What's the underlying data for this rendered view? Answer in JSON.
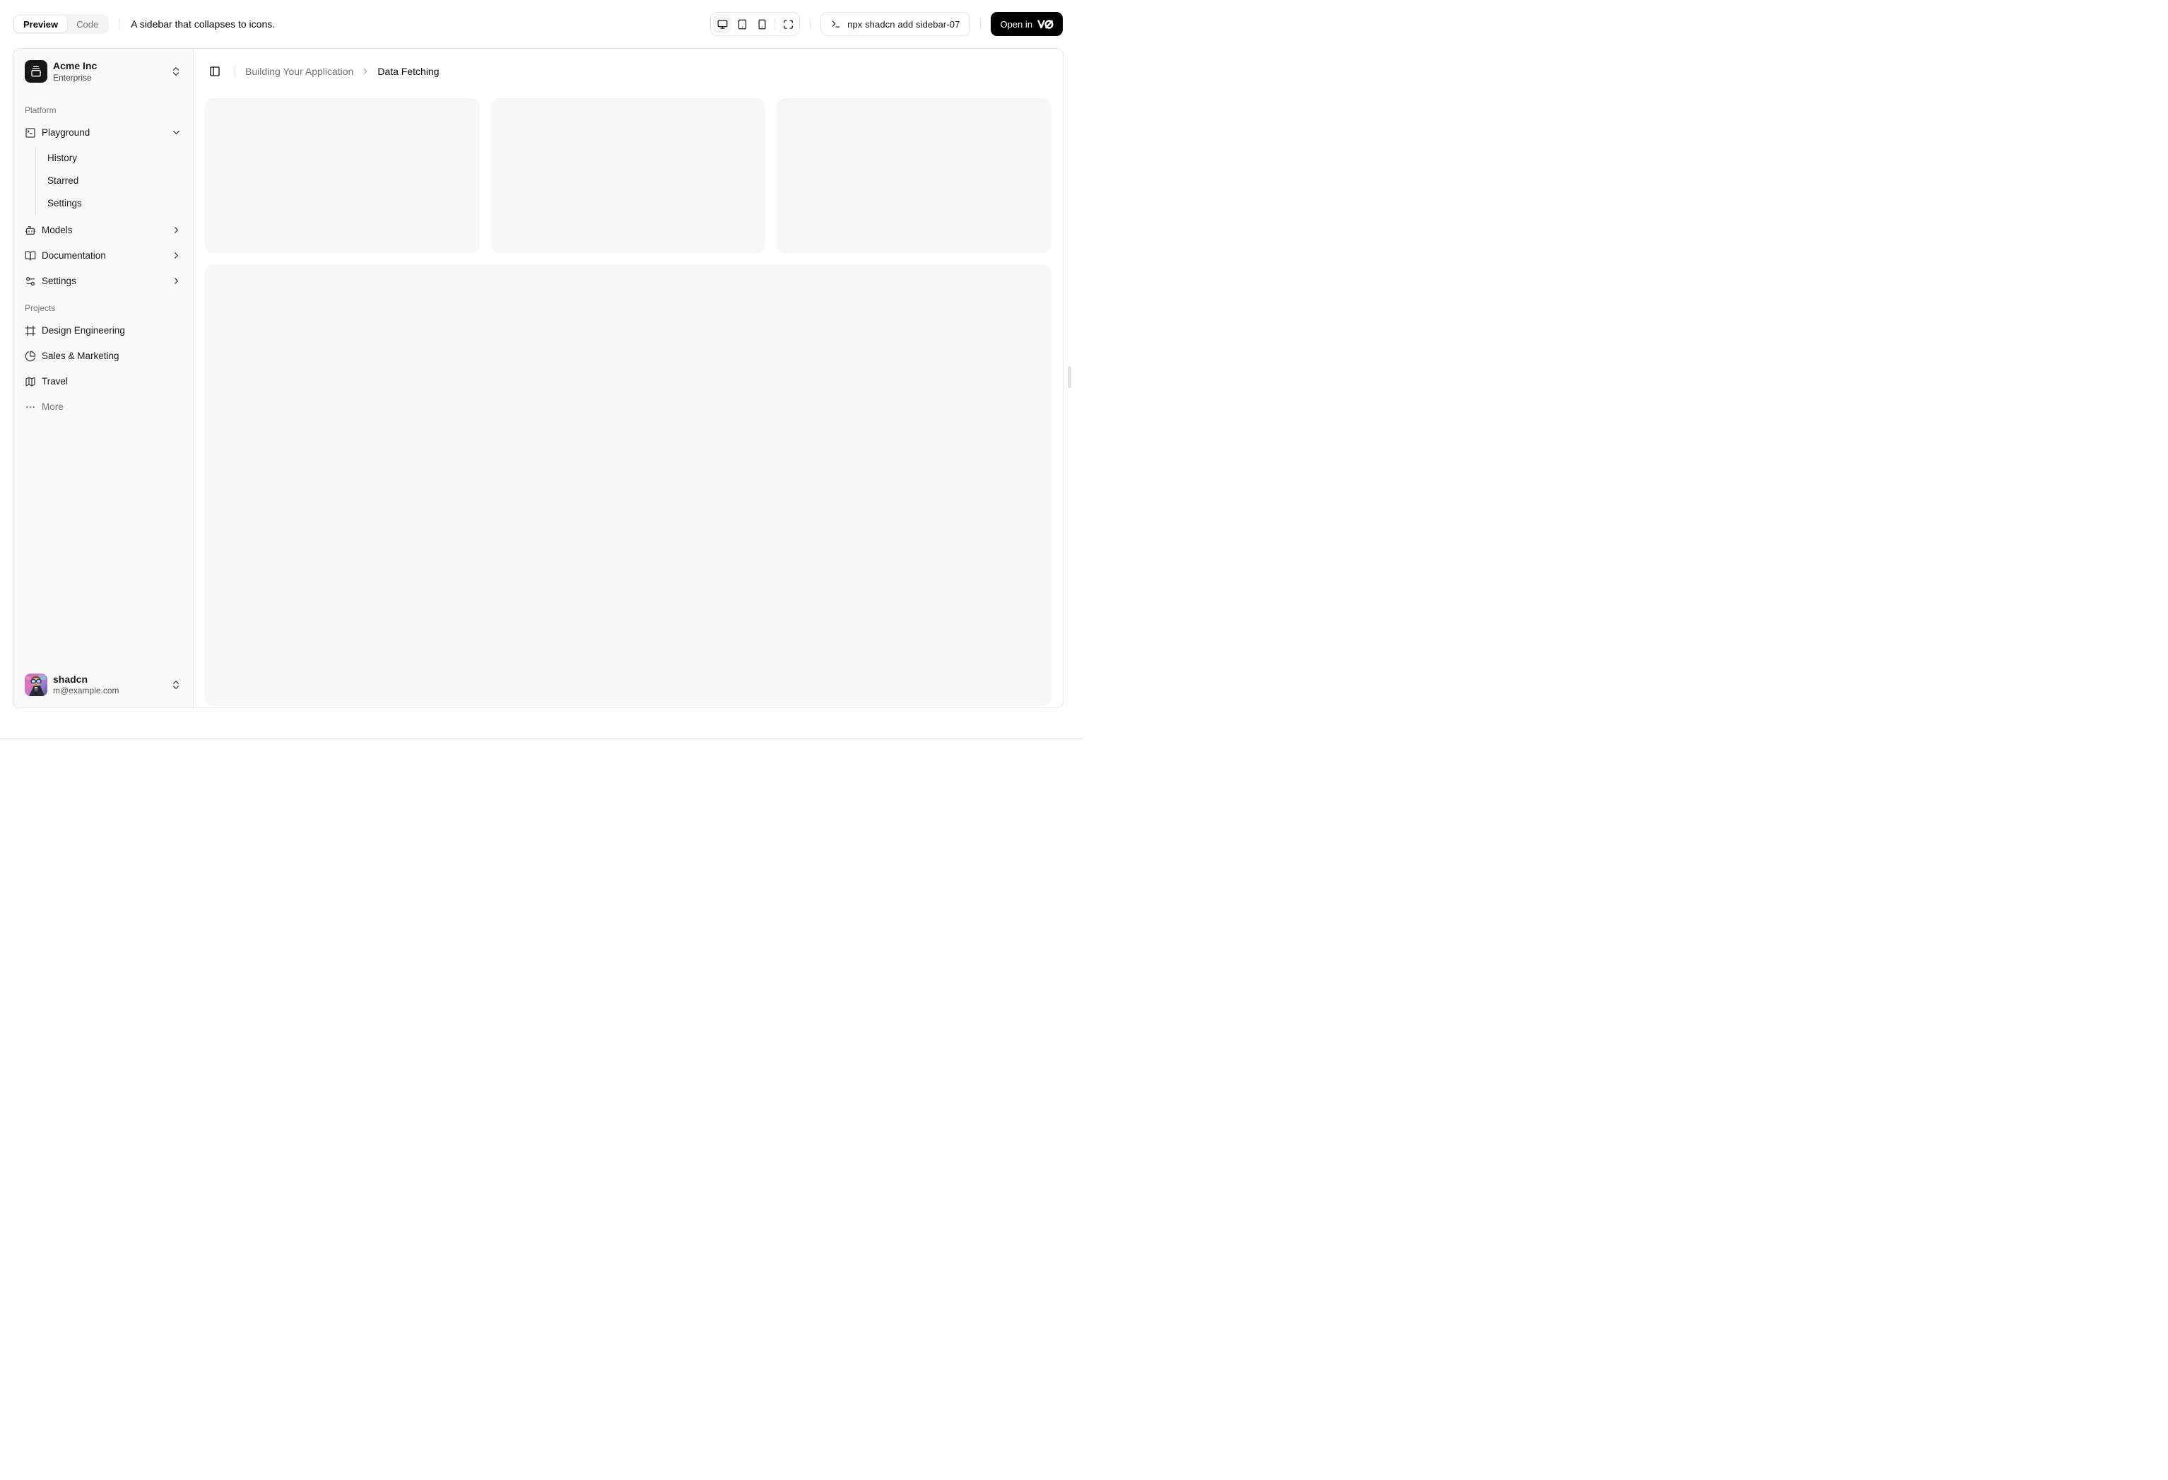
{
  "toolbar": {
    "tabs": {
      "preview": "Preview",
      "code": "Code"
    },
    "description": "A sidebar that collapses to icons.",
    "command": "npx shadcn add sidebar-07",
    "open_in_label": "Open in",
    "open_in_logo": "v0-logo",
    "device_icons": [
      "monitor-icon",
      "tablet-icon",
      "smartphone-icon",
      "maximize-icon"
    ]
  },
  "sidebar": {
    "team": {
      "name": "Acme Inc",
      "plan": "Enterprise",
      "logo_icon": "gallery-vertical-end-icon"
    },
    "groups": [
      {
        "label": "Platform",
        "items": [
          {
            "label": "Playground",
            "icon": "square-terminal-icon",
            "chevron": "down",
            "children": [
              {
                "label": "History"
              },
              {
                "label": "Starred"
              },
              {
                "label": "Settings"
              }
            ]
          },
          {
            "label": "Models",
            "icon": "bot-icon",
            "chevron": "right"
          },
          {
            "label": "Documentation",
            "icon": "book-open-icon",
            "chevron": "right"
          },
          {
            "label": "Settings",
            "icon": "settings-2-icon",
            "chevron": "right"
          }
        ]
      },
      {
        "label": "Projects",
        "items": [
          {
            "label": "Design Engineering",
            "icon": "frame-icon"
          },
          {
            "label": "Sales & Marketing",
            "icon": "chart-pie-icon"
          },
          {
            "label": "Travel",
            "icon": "map-icon"
          },
          {
            "label": "More",
            "icon": "ellipsis-icon",
            "muted": true
          }
        ]
      }
    ],
    "user": {
      "name": "shadcn",
      "email": "m@example.com"
    }
  },
  "main": {
    "breadcrumb": {
      "parent": "Building Your Application",
      "current": "Data Fetching"
    },
    "placeholder_cards": 3
  },
  "colors": {
    "accent_dark": "#000000",
    "sidebar_bg": "#fafafa",
    "card_bg": "#f7f7f8",
    "border": "#e4e4e7",
    "muted_text": "#71717a"
  }
}
